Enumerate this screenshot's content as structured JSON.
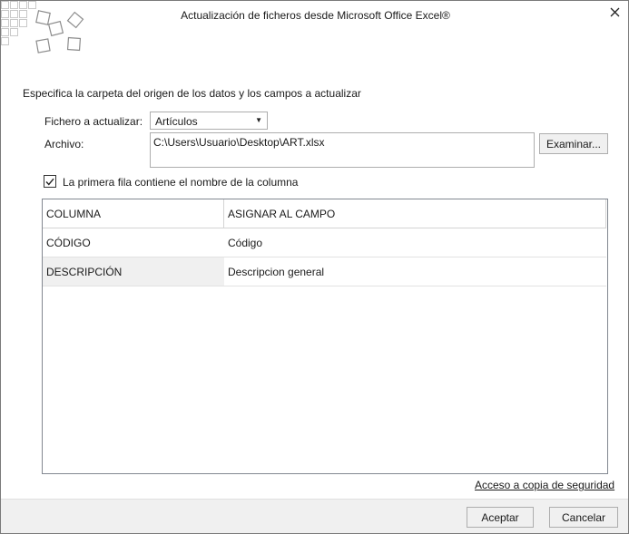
{
  "window": {
    "title": "Actualización de ficheros desde Microsoft Office Excel®",
    "close_icon": "close-icon"
  },
  "main": {
    "heading": "Especifica la carpeta del origen de los datos y los campos a actualizar",
    "fichero_label": "Fichero a actualizar:",
    "fichero_value": "Artículos",
    "archivo_label": "Archivo:",
    "archivo_value": "C:\\Users\\Usuario\\Desktop\\ART.xlsx",
    "examinar_label": "Examinar...",
    "checkbox_label": "La primera fila contiene el nombre de la columna",
    "checkbox_checked": true
  },
  "grid": {
    "headers": [
      "COLUMNA",
      "ASIGNAR AL CAMPO"
    ],
    "rows": [
      [
        "CÓDIGO",
        "Código"
      ],
      [
        "DESCRIPCIÓN",
        "Descripcion general"
      ]
    ]
  },
  "footer": {
    "backup_link": "Acceso a copia de seguridad",
    "accept_label": "Aceptar",
    "cancel_label": "Cancelar"
  }
}
